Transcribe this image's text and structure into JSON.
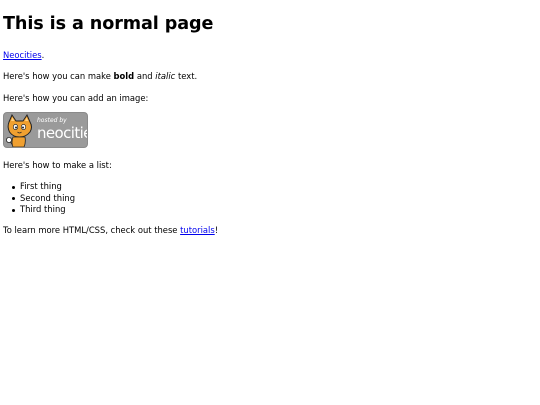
{
  "heading": "This is a normal page",
  "neocities_link": "Neocities",
  "neocities_suffix": ".",
  "formatting": {
    "prefix": "Here's how you can make ",
    "bold": "bold",
    "middle": " and ",
    "italic": "italic",
    "suffix": " text."
  },
  "image_intro": "Here's how you can add an image:",
  "badge": {
    "small_text": "hosted by",
    "big_text": "neocities",
    "icon": "neocities-cat-icon"
  },
  "list_intro": "Here's how to make a list:",
  "list_items": [
    "First thing",
    "Second thing",
    "Third thing"
  ],
  "learn": {
    "prefix": "To learn more HTML/CSS, check out these ",
    "link": "tutorials",
    "suffix": "!"
  },
  "colors": {
    "link": "#0000ee",
    "badge_bg": "#9a9a9a",
    "cat_orange": "#f0a030"
  }
}
